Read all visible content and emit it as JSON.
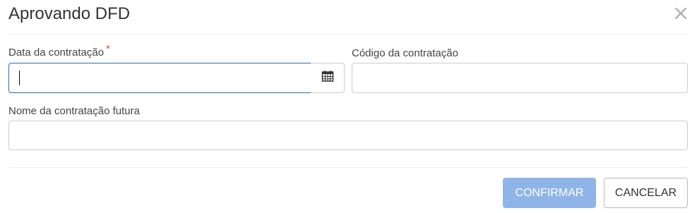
{
  "modal": {
    "title": "Aprovando DFD"
  },
  "form": {
    "data_contratacao": {
      "label": "Data da contratação",
      "required_mark": "*",
      "value": "",
      "placeholder": ""
    },
    "codigo_contratacao": {
      "label": "Código da contratação",
      "value": "",
      "placeholder": ""
    },
    "nome_contratacao_futura": {
      "label": "Nome da contratação futura",
      "value": "",
      "placeholder": ""
    }
  },
  "footer": {
    "confirm_label": "CONFIRMAR",
    "cancel_label": "CANCELAR"
  },
  "icons": {
    "close": "close-icon",
    "calendar": "calendar-icon"
  },
  "colors": {
    "required": "#d9534f",
    "focus_border": "#2f6aa3",
    "confirm_disabled_bg": "#8fb5e8"
  }
}
